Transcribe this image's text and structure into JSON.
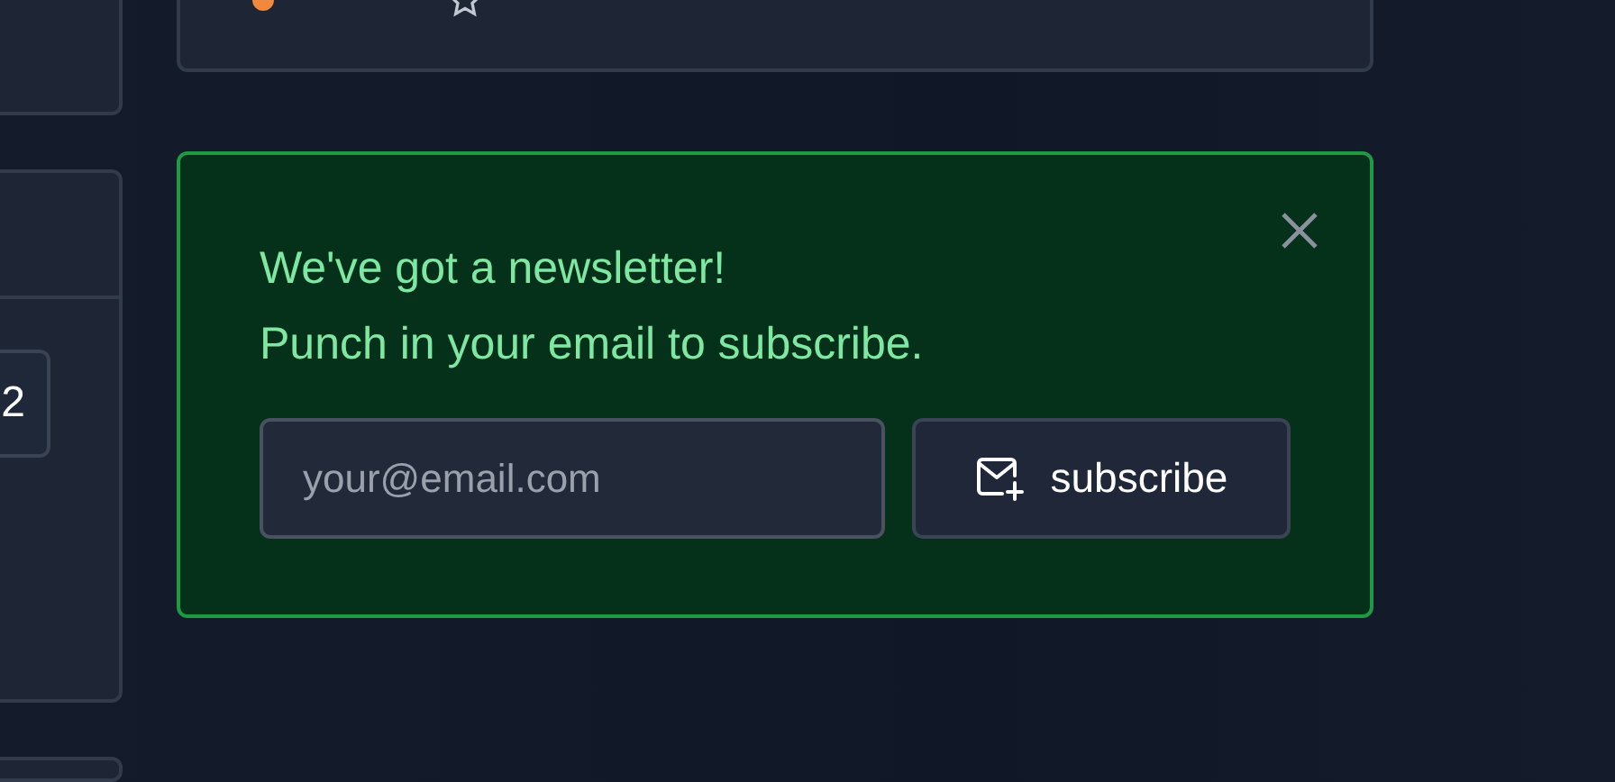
{
  "sidebar": {
    "page_button": "2"
  },
  "newsletter": {
    "lines": [
      "We've got a newsletter!",
      "Punch in your email to subscribe."
    ],
    "email": {
      "placeholder": "your@email.com"
    },
    "subscribe_button": "subscribe"
  }
}
